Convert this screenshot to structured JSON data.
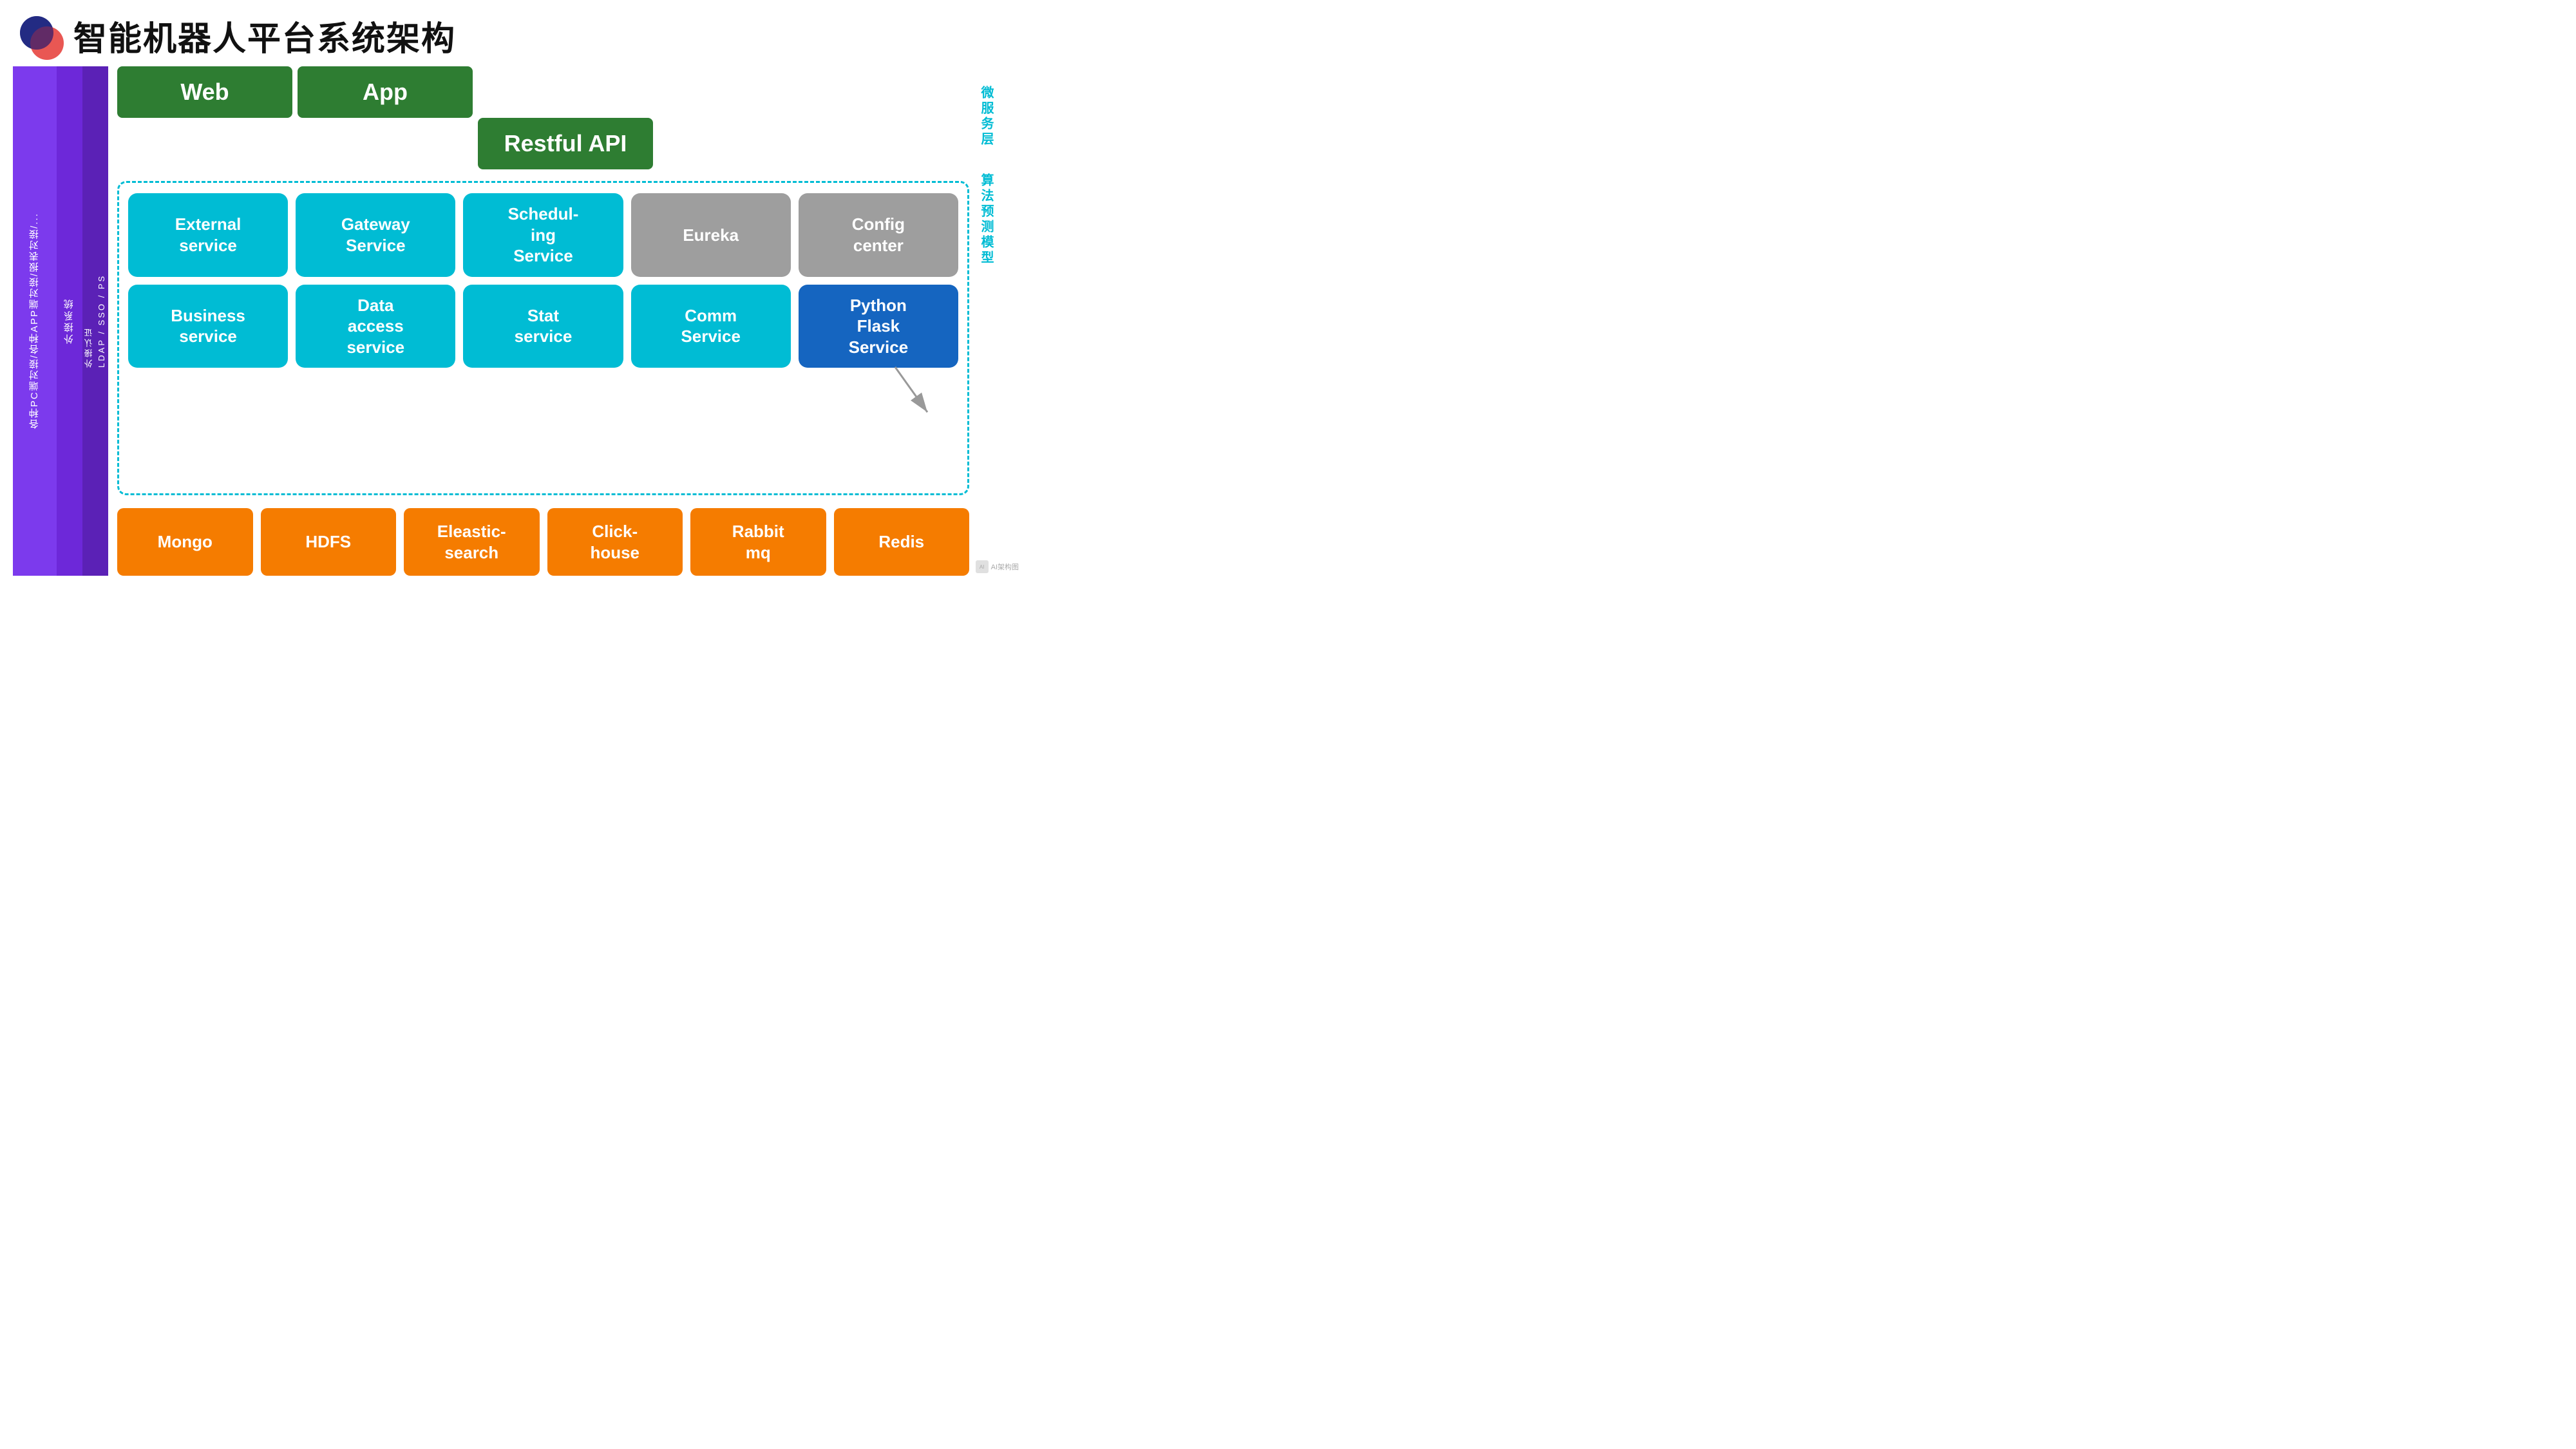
{
  "header": {
    "title": "智能机器人平台系统架构"
  },
  "left_labels": {
    "col1": "各种PC端对接/各种APP端对接/报表对接/...",
    "col2": "外接系统",
    "col3": "外接认证",
    "col3_sub": "LDAP / SSO / PS"
  },
  "top_sections": {
    "web": "Web",
    "app": "App",
    "api": "Restful API"
  },
  "services_row1": [
    {
      "name": "External service",
      "type": "cyan"
    },
    {
      "name": "Gateway Service",
      "type": "cyan"
    },
    {
      "name": "Scheduling Service",
      "type": "cyan"
    },
    {
      "name": "Eureka",
      "type": "gray"
    },
    {
      "name": "Config center",
      "type": "gray"
    }
  ],
  "services_row2": [
    {
      "name": "Business service",
      "type": "cyan"
    },
    {
      "name": "Data access service",
      "type": "cyan"
    },
    {
      "name": "Stat service",
      "type": "cyan"
    },
    {
      "name": "Comm Service",
      "type": "cyan"
    },
    {
      "name": "Python Flask Service",
      "type": "dark_blue"
    }
  ],
  "databases": [
    {
      "name": "Mongo"
    },
    {
      "name": "HDFS"
    },
    {
      "name": "Eleastic-search"
    },
    {
      "name": "Click-house"
    },
    {
      "name": "Rabbit mq"
    },
    {
      "name": "Redis"
    }
  ],
  "right_labels": {
    "label1": "微服务层",
    "label2": "算法预测模型"
  },
  "watermark": "AI架构图"
}
